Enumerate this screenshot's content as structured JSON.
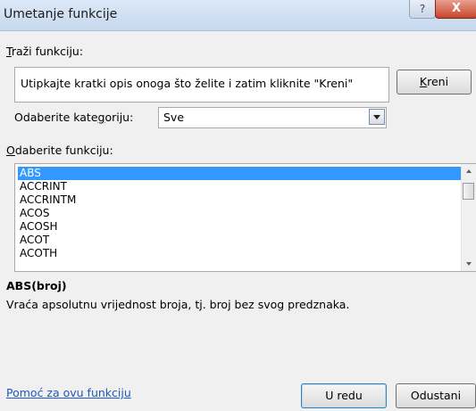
{
  "window": {
    "title": "Umetanje funkcije",
    "help_glyph": "?",
    "close_glyph": "X"
  },
  "search": {
    "label_prefix": "",
    "label_hot": "T",
    "label_rest": "raži funkciju:",
    "value": "Utipkajte kratki opis onoga što želite i zatim kliknite \"Kreni\"",
    "go_button_hot": "K",
    "go_button_rest": "reni"
  },
  "category": {
    "label_prefix": "Odaberite kate",
    "label_hot": "g",
    "label_rest": "oriju:",
    "selected": "Sve"
  },
  "functions": {
    "label_prefix": "",
    "label_hot": "O",
    "label_rest": "daberite funkciju:",
    "items": [
      "ABS",
      "ACCRINT",
      "ACCRINTM",
      "ACOS",
      "ACOSH",
      "ACOT",
      "ACOTH"
    ],
    "selected_index": 0
  },
  "description": {
    "signature": "ABS(broj)",
    "text": "Vraća apsolutnu vrijednost broja, tj. broj bez svog predznaka."
  },
  "footer": {
    "help_link": "Pomoć za ovu funkciju",
    "ok_label": "U redu",
    "cancel_label": "Odustani"
  }
}
